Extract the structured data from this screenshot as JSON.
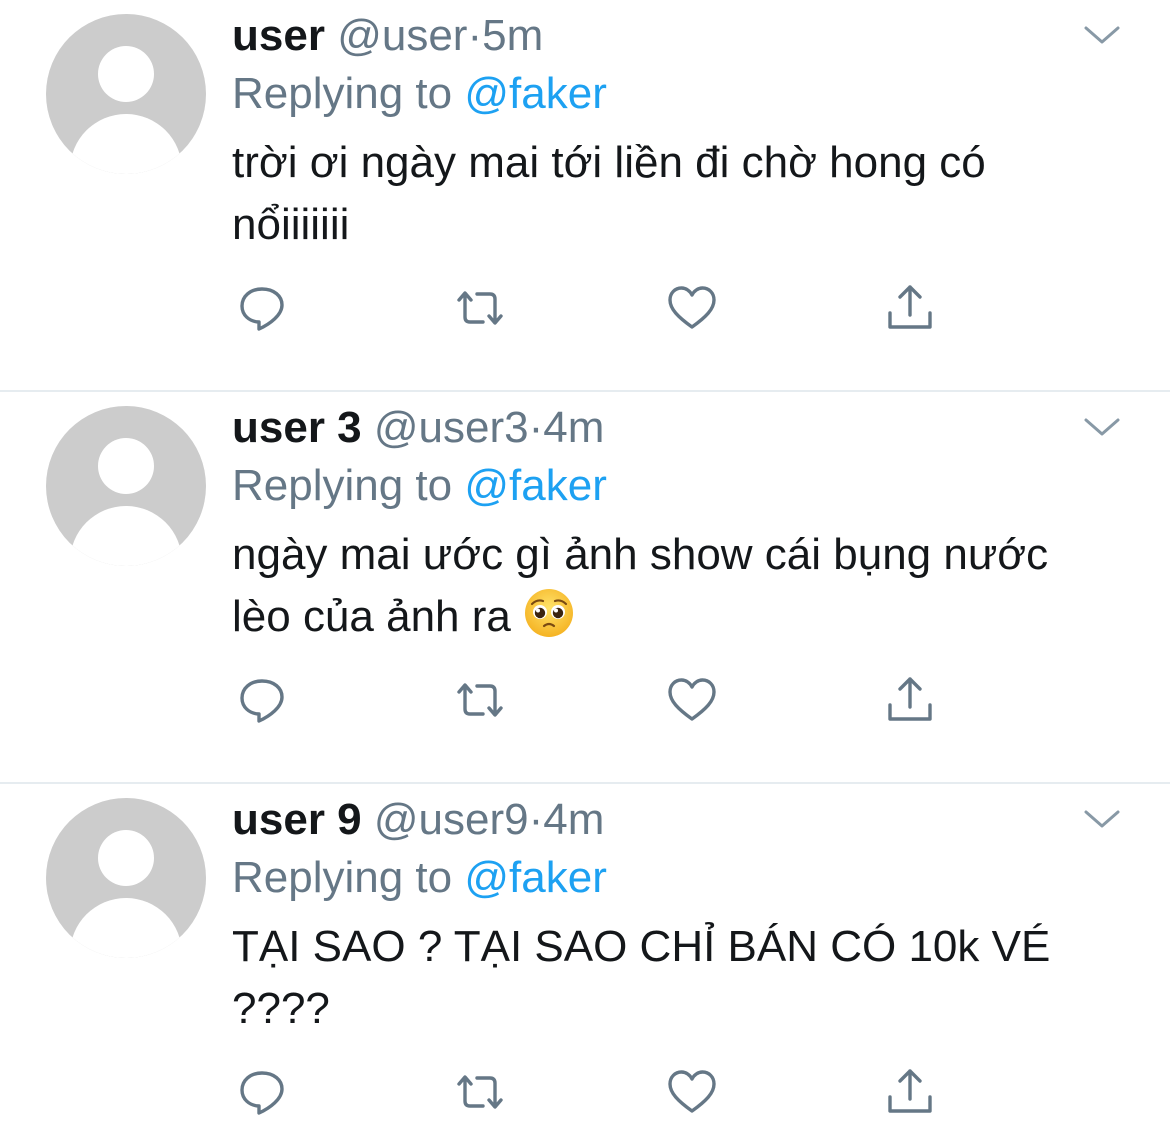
{
  "colors": {
    "handle": "#657786",
    "link": "#1da1f2",
    "text": "#14171a",
    "avatar_bg": "#cccccc",
    "divider": "#e6ecf0"
  },
  "icons": {
    "reply": "speech-bubble-icon",
    "retweet": "retweet-arrows-icon",
    "like": "heart-icon",
    "share": "share-upload-icon",
    "menu": "chevron-down-icon"
  },
  "tweets": [
    {
      "display_name": "user",
      "handle": "@user",
      "separator": "·",
      "time": "5m",
      "replying_prefix": "Replying to",
      "replying_handle": "@faker",
      "text": "trời ơi ngày mai tới liền đi chờ hong có nổiiiiiii"
    },
    {
      "display_name": "user 3",
      "handle": "@user3",
      "separator": "·",
      "time": "4m",
      "replying_prefix": "Replying to",
      "replying_handle": "@faker",
      "text": "ngày mai ước gì ảnh show cái bụng nước lèo của ảnh ra",
      "emoji": "pleading-face-emoji"
    },
    {
      "display_name": "user 9",
      "handle": "@user9",
      "separator": "·",
      "time": "4m",
      "replying_prefix": "Replying to",
      "replying_handle": "@faker",
      "text": "TẠI SAO ? TẠI SAO CHỈ BÁN CÓ 10k VÉ ????"
    }
  ]
}
